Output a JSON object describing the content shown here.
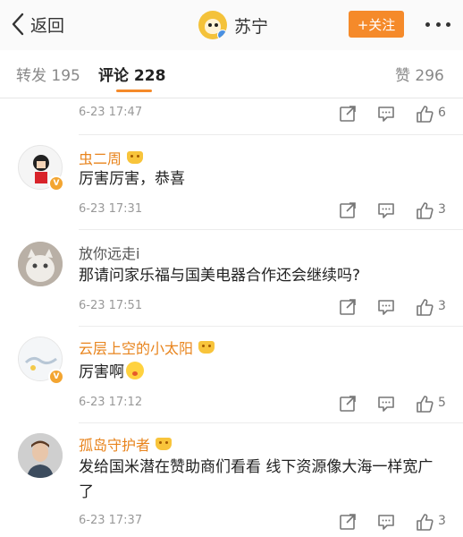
{
  "header": {
    "back_label": "返回",
    "title": "苏宁",
    "follow_label": "+关注"
  },
  "tabs": [
    {
      "label": "转发 195"
    },
    {
      "label": "评论 228"
    },
    {
      "label": "赞 296"
    }
  ],
  "comments": [
    {
      "name": "",
      "text": "",
      "time": "6-23 17:47",
      "likes": "6"
    },
    {
      "name": "虫二周",
      "text": "厉害厉害，恭喜",
      "time": "6-23 17:31",
      "likes": "3",
      "verified": "V"
    },
    {
      "name": "放你远走i",
      "text": "那请问家乐福与国美电器合作还会继续吗?",
      "time": "6-23 17:51",
      "likes": "3"
    },
    {
      "name": "云层上空的小太阳",
      "text": "厉害啊",
      "time": "6-23 17:12",
      "likes": "5",
      "verified": "V"
    },
    {
      "name": "孤岛守护者",
      "text": "发给国米潜在赞助商们看看 线下资源像大海一样宽广了",
      "time": "6-23 17:37",
      "likes": "3"
    }
  ],
  "colors": {
    "accent": "#f58a2a",
    "name_orange": "#e8841d",
    "verified_badge": "#f3a531"
  },
  "icons": [
    "back-chevron-icon",
    "more-dots-icon",
    "share-icon",
    "comment-icon",
    "like-icon",
    "crown-icon"
  ]
}
